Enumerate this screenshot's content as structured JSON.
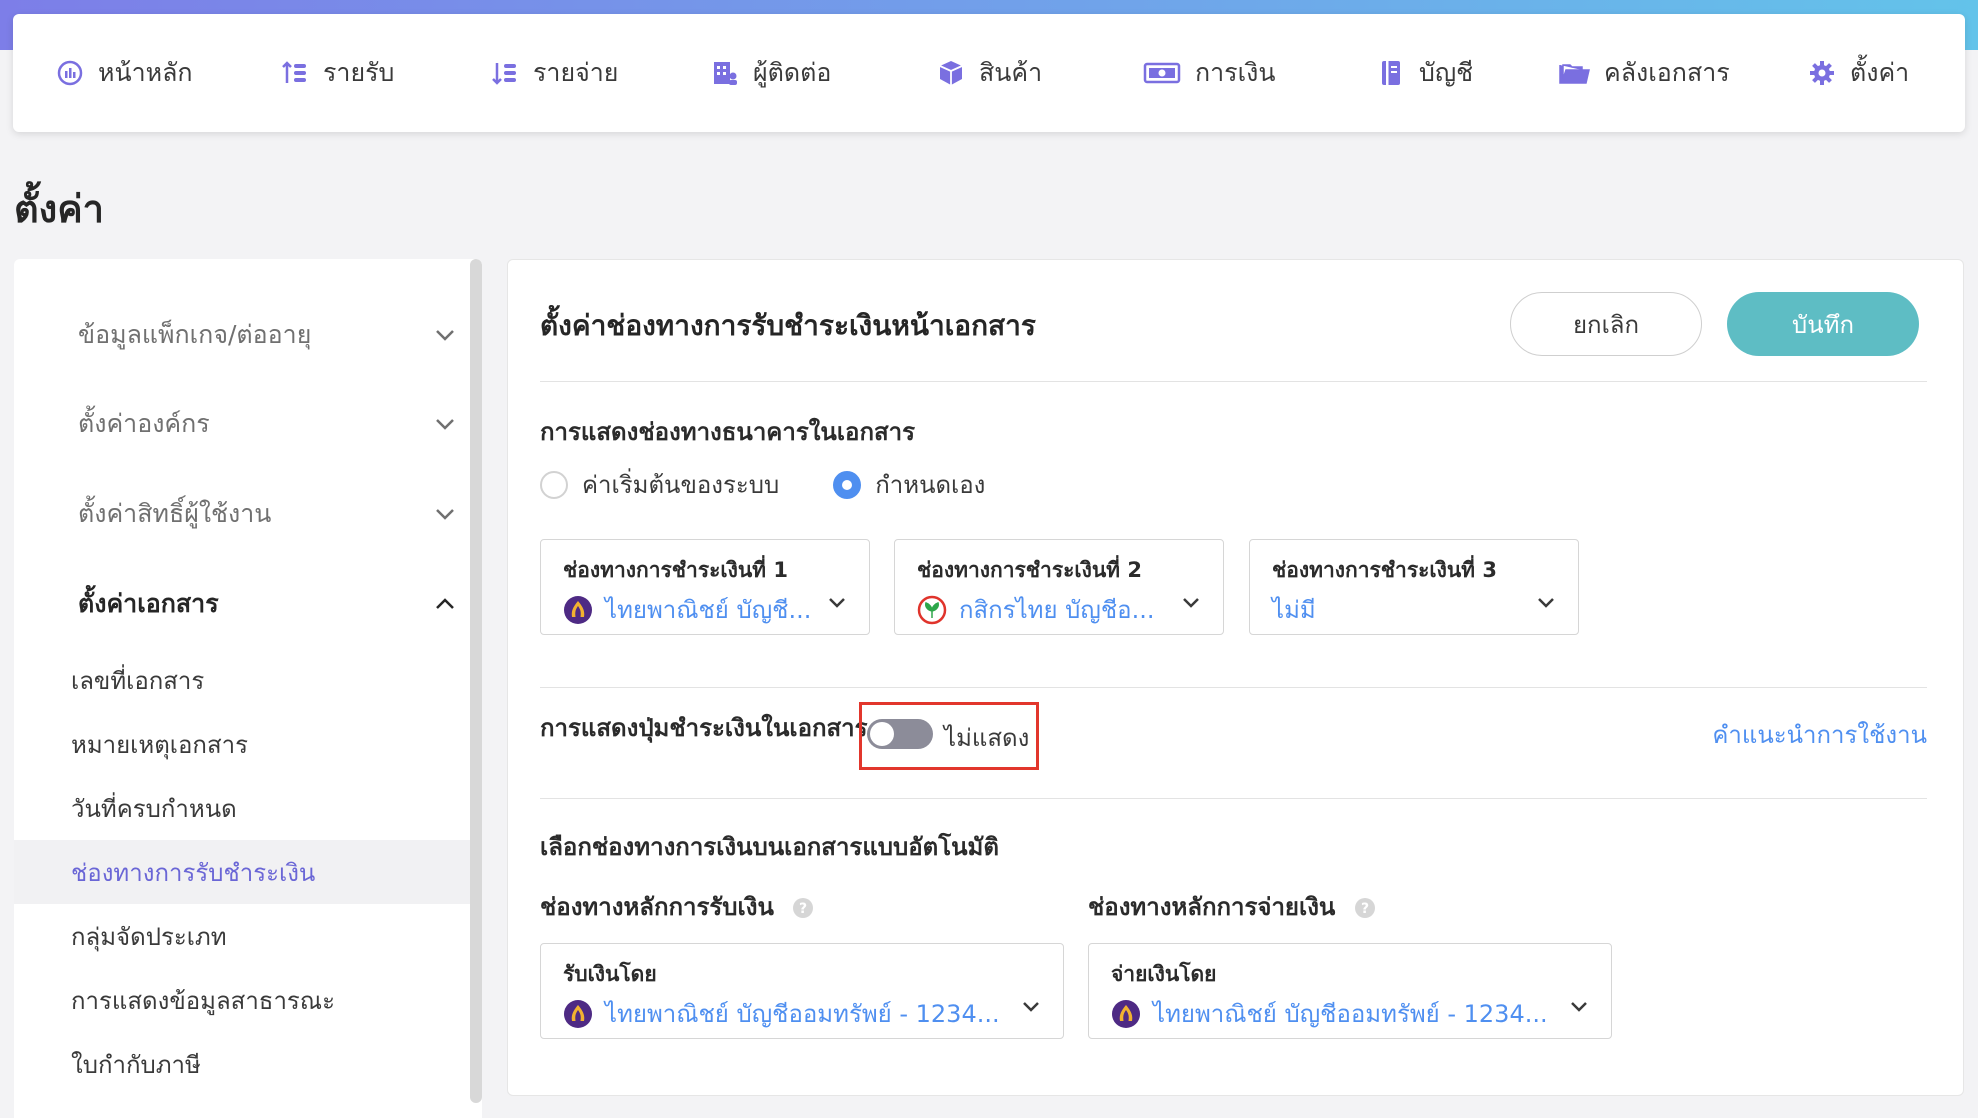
{
  "nav": {
    "items": [
      {
        "label": "หน้าหลัก",
        "icon": "dashboard-icon"
      },
      {
        "label": "รายรับ",
        "icon": "income-icon"
      },
      {
        "label": "รายจ่าย",
        "icon": "expense-icon"
      },
      {
        "label": "ผู้ติดต่อ",
        "icon": "contacts-icon"
      },
      {
        "label": "สินค้า",
        "icon": "product-box-icon"
      },
      {
        "label": "การเงิน",
        "icon": "money-icon"
      },
      {
        "label": "บัญชี",
        "icon": "ledger-icon"
      },
      {
        "label": "คลังเอกสาร",
        "icon": "folder-icon"
      },
      {
        "label": "ตั้งค่า",
        "icon": "gear-icon"
      }
    ]
  },
  "page": {
    "title": "ตั้งค่า"
  },
  "sidebar": {
    "groups": [
      {
        "label": "ข้อมูลแพ็กเกจ/ต่ออายุ",
        "expanded": false
      },
      {
        "label": "ตั้งค่าองค์กร",
        "expanded": false
      },
      {
        "label": "ตั้งค่าสิทธิ์ผู้ใช้งาน",
        "expanded": false
      },
      {
        "label": "ตั้งค่าเอกสาร",
        "expanded": true
      }
    ],
    "subitems": [
      {
        "label": "เลขที่เอกสาร"
      },
      {
        "label": "หมายเหตุเอกสาร"
      },
      {
        "label": "วันที่ครบกำหนด"
      },
      {
        "label": "ช่องทางการรับชำระเงิน",
        "selected": true
      },
      {
        "label": "กลุ่มจัดประเภท"
      },
      {
        "label": "การแสดงข้อมูลสาธารณะ"
      },
      {
        "label": "ใบกำกับภาษี"
      }
    ]
  },
  "main": {
    "title": "ตั้งค่าช่องทางการรับชำระเงินหน้าเอกสาร",
    "cancel_label": "ยกเลิก",
    "save_label": "บันทึก",
    "bank_display": {
      "label": "การแสดงช่องทางธนาคารในเอกสาร",
      "options": [
        "ค่าเริ่มต้นของระบบ",
        "กำหนดเอง"
      ],
      "selected": "กำหนดเอง"
    },
    "channels": [
      {
        "label": "ช่องทางการชำระเงินที่ 1",
        "value": "ไทยพาณิชย์ บัญชี...",
        "bank": "scb-logo-icon"
      },
      {
        "label": "ช่องทางการชำระเงินที่ 2",
        "value": "กสิกรไทย บัญชีอ...",
        "bank": "kbank-logo-icon"
      },
      {
        "label": "ช่องทางการชำระเงินที่ 3",
        "value": "ไม่มี",
        "bank": ""
      }
    ],
    "payment_button": {
      "label": "การแสดงปุ่มชำระเงินในเอกสาร",
      "state_label": "ไม่แสดง",
      "enabled": false,
      "help_link": "คำแนะนำการใช้งาน"
    },
    "auto_channel": {
      "label": "เลือกช่องทางการเงินบนเอกสารแบบอัตโนมัติ",
      "receive": {
        "heading": "ช่องทางหลักการรับเงิน",
        "field_label": "รับเงินโดย",
        "value": "ไทยพาณิชย์ บัญชีออมทรัพย์ - 1234..."
      },
      "pay": {
        "heading": "ช่องทางหลักการจ่ายเงิน",
        "field_label": "จ่ายเงินโดย",
        "value": "ไทยพาณิชย์ บัญชีออมทรัพย์ - 1234..."
      }
    }
  },
  "colors": {
    "accent": "#5ebdc4",
    "link": "#4f8ff0",
    "sidebar_active": "#6a66d6",
    "highlight": "#e2362c"
  }
}
